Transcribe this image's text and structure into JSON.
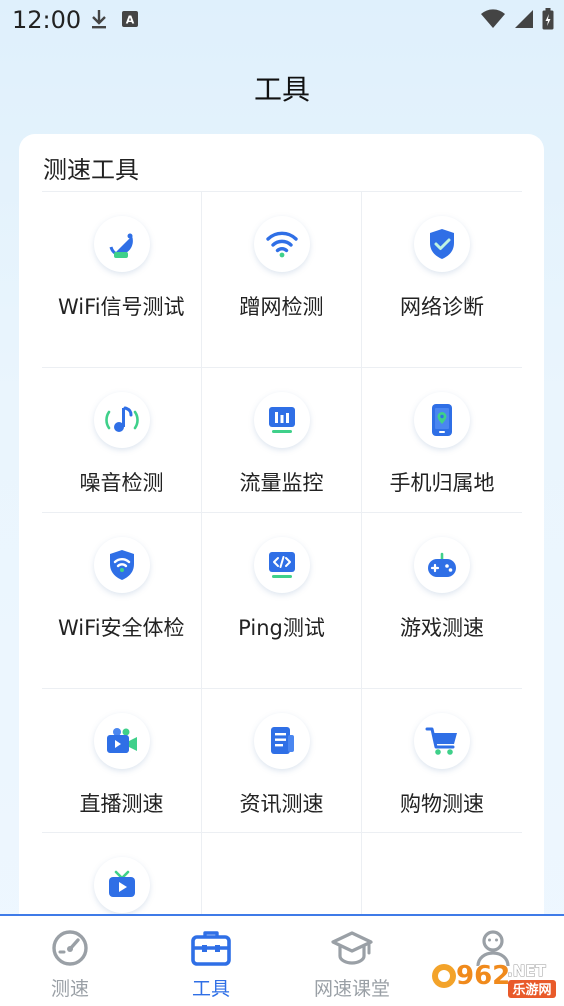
{
  "status_bar": {
    "time": "12:00"
  },
  "page": {
    "title": "工具"
  },
  "card": {
    "title": "测速工具",
    "tools": [
      {
        "label": "WiFi信号测试",
        "icon": "satellite-dish-icon"
      },
      {
        "label": "蹭网检测",
        "icon": "wifi-icon"
      },
      {
        "label": "网络诊断",
        "icon": "shield-check-icon"
      },
      {
        "label": "噪音检测",
        "icon": "music-note-icon"
      },
      {
        "label": "流量监控",
        "icon": "bar-monitor-icon"
      },
      {
        "label": "手机归属地",
        "icon": "phone-location-icon"
      },
      {
        "label": "WiFi安全体检",
        "icon": "wifi-shield-icon"
      },
      {
        "label": "Ping测试",
        "icon": "code-monitor-icon"
      },
      {
        "label": "游戏测速",
        "icon": "gamepad-icon"
      },
      {
        "label": "直播测速",
        "icon": "video-camera-icon"
      },
      {
        "label": "资讯测速",
        "icon": "news-document-icon"
      },
      {
        "label": "购物测速",
        "icon": "shopping-cart-icon"
      },
      {
        "label": "",
        "icon": "tv-play-icon"
      }
    ]
  },
  "tabbar": {
    "tabs": [
      {
        "label": "测速",
        "icon": "speedometer-icon",
        "active": false
      },
      {
        "label": "工具",
        "icon": "toolbox-icon",
        "active": true
      },
      {
        "label": "网速课堂",
        "icon": "graduation-cap-icon",
        "active": false
      },
      {
        "label": "",
        "icon": "profile-icon",
        "active": false
      }
    ]
  },
  "watermark": {
    "number": "962",
    "suffix": ".NET",
    "sub": "乐游网"
  },
  "colors": {
    "accent": "#2f6fe6",
    "inactive": "#9aa0a6",
    "green": "#3fd08a"
  }
}
